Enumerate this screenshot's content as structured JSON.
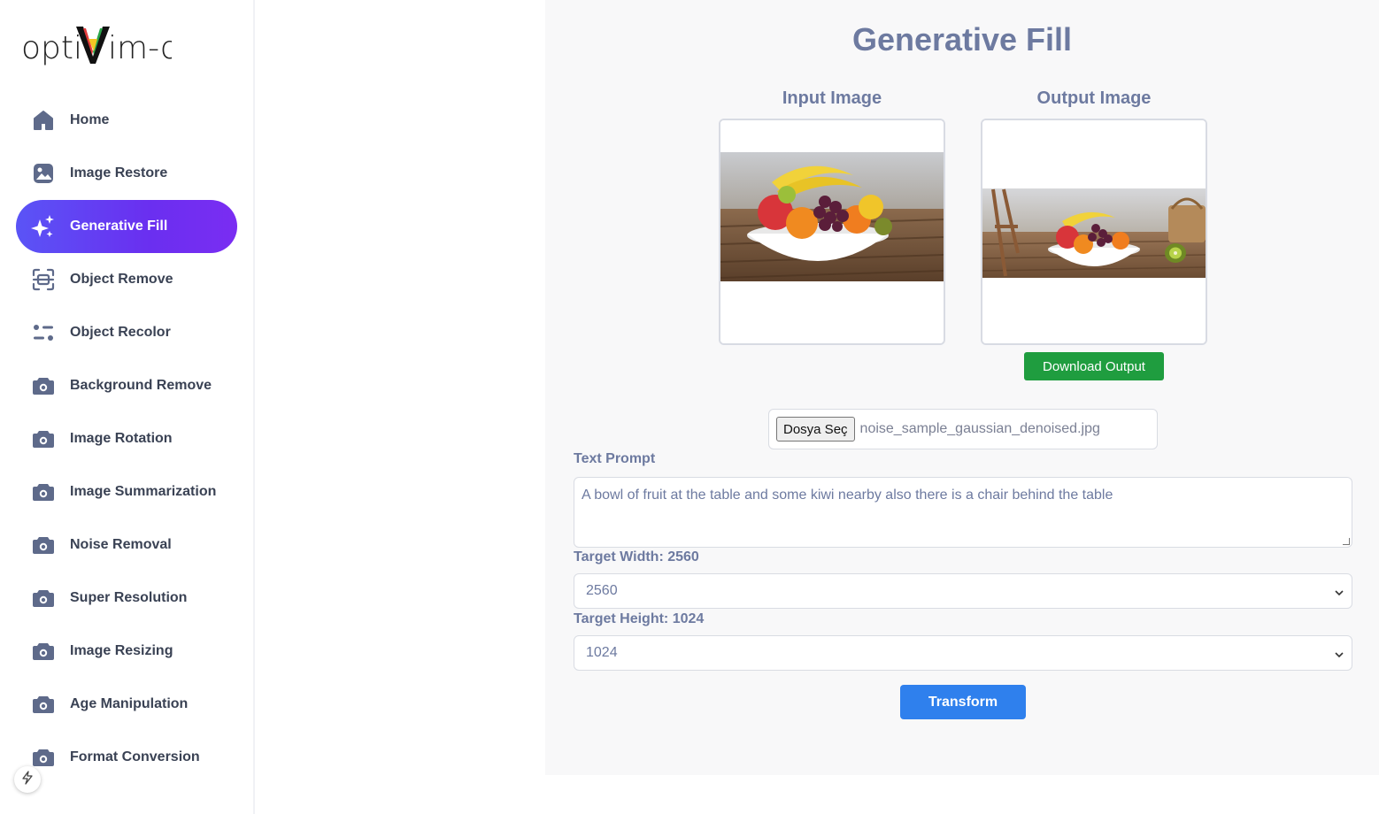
{
  "app": {
    "logo_text": "optiVim-o"
  },
  "sidebar": {
    "items": [
      {
        "label": "Home",
        "icon": "home-icon"
      },
      {
        "label": "Image Restore",
        "icon": "image-icon"
      },
      {
        "label": "Generative Fill",
        "icon": "sparkles-icon",
        "active": true
      },
      {
        "label": "Object Remove",
        "icon": "scan-icon"
      },
      {
        "label": "Object Recolor",
        "icon": "sliders-icon"
      },
      {
        "label": "Background Remove",
        "icon": "camera-icon"
      },
      {
        "label": "Image Rotation",
        "icon": "camera-icon"
      },
      {
        "label": "Image Summarization",
        "icon": "camera-icon"
      },
      {
        "label": "Noise Removal",
        "icon": "camera-icon"
      },
      {
        "label": "Super Resolution",
        "icon": "camera-icon"
      },
      {
        "label": "Image Resizing",
        "icon": "camera-icon"
      },
      {
        "label": "Age Manipulation",
        "icon": "camera-icon"
      },
      {
        "label": "Format Conversion",
        "icon": "camera-icon"
      }
    ]
  },
  "main": {
    "title": "Generative Fill",
    "input_title": "Input Image",
    "output_title": "Output Image",
    "download_label": "Download Output",
    "file": {
      "button_label": "Dosya Seç",
      "file_name": "noise_sample_gaussian_denoised.jpg"
    },
    "prompt_label": "Text Prompt",
    "prompt_value": "A bowl of fruit at the table and some kiwi nearby also there is a chair behind the table",
    "width_label": "Target Width: 2560",
    "width_value": "2560",
    "height_label": "Target Height: 1024",
    "height_value": "1024",
    "transform_label": "Transform"
  },
  "colors": {
    "accent_gradient_start": "#5a54f6",
    "accent_gradient_end": "#7a2df2",
    "heading": "#6d7aa0",
    "download_green": "#1f9d3f",
    "transform_blue": "#2f80ed",
    "nav_icon": "#5e6a8a"
  }
}
